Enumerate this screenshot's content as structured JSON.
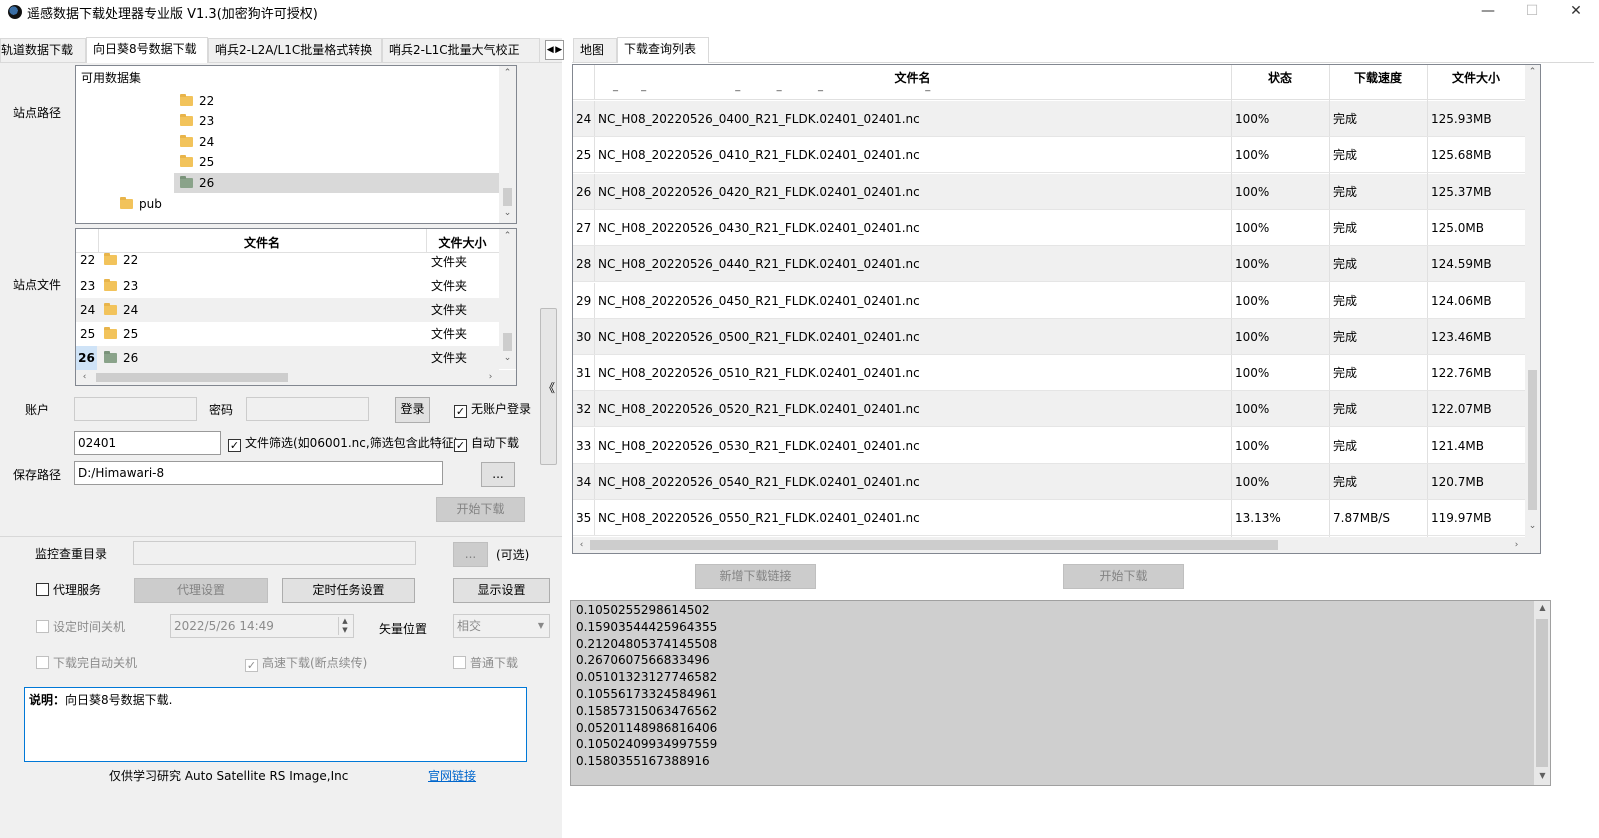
{
  "window": {
    "title": "遥感数据下载处理器专业版 V1.3(加密狗许可授权)",
    "minimize": "—",
    "maximize": "☐",
    "close": "✕"
  },
  "left_tabs": [
    "轨道数据下载",
    "向日葵8号数据下载",
    "哨兵2-L2A/L1C批量格式转换",
    "哨兵2-L1C批量大气校正"
  ],
  "tab_scroll": {
    "left": "◀",
    "right": "▶"
  },
  "station_path": {
    "label": "站点路径",
    "root": "可用数据集",
    "items": [
      "22",
      "23",
      "24",
      "25",
      "26"
    ],
    "selected": "26",
    "pub": "pub"
  },
  "station_files": {
    "label": "站点文件",
    "col_name": "文件名",
    "col_size": "文件大小",
    "rows": [
      {
        "idx": "22",
        "name": "22",
        "size": "文件夹"
      },
      {
        "idx": "23",
        "name": "23",
        "size": "文件夹"
      },
      {
        "idx": "24",
        "name": "24",
        "size": "文件夹"
      },
      {
        "idx": "25",
        "name": "25",
        "size": "文件夹"
      },
      {
        "idx": "26",
        "name": "26",
        "size": "文件夹"
      }
    ]
  },
  "collapse_glyph": "《",
  "account": {
    "label": "账户",
    "password_label": "密码",
    "login_button": "登录",
    "no_account_login": "无账户登录"
  },
  "filter": {
    "value": "02401",
    "label": "文件筛选(如06001.nc,筛选包含此特征)",
    "auto_download": "自动下载"
  },
  "save": {
    "label": "保存路径",
    "value": "D:/Himawari-8",
    "browse": "...",
    "start": "开始下载"
  },
  "monitor": {
    "label": "监控查重目录",
    "browse": "...",
    "optional": "(可选)"
  },
  "proxy": {
    "label": "代理服务",
    "settings": "代理设置",
    "timer": "定时任务设置",
    "display": "显示设置"
  },
  "shutdown": {
    "label": "设定时间关机",
    "datetime": "2022/5/26 14:49",
    "vector_label": "矢量位置",
    "vector_value": "相交"
  },
  "after_download": {
    "auto_shutdown": "下载完自动关机",
    "high_speed": "高速下载(断点续传)",
    "normal": "普通下载"
  },
  "note": {
    "bold": "说明：",
    "text": "向日葵8号数据下载."
  },
  "footer": {
    "text": "仅供学习研究   Auto Satellite RS Image,Inc",
    "link": "官网链接"
  },
  "right_tabs": [
    "地图",
    "下载查询列表"
  ],
  "grid": {
    "col_name": "文件名",
    "col_status": "状态",
    "col_speed": "下载速度",
    "col_size": "文件大小",
    "rows": [
      {
        "idx": "24",
        "name": "NC_H08_20220526_0400_R21_FLDK.02401_02401.nc",
        "status": "100%",
        "speed": "完成",
        "size": "125.93MB"
      },
      {
        "idx": "25",
        "name": "NC_H08_20220526_0410_R21_FLDK.02401_02401.nc",
        "status": "100%",
        "speed": "完成",
        "size": "125.68MB"
      },
      {
        "idx": "26",
        "name": "NC_H08_20220526_0420_R21_FLDK.02401_02401.nc",
        "status": "100%",
        "speed": "完成",
        "size": "125.37MB"
      },
      {
        "idx": "27",
        "name": "NC_H08_20220526_0430_R21_FLDK.02401_02401.nc",
        "status": "100%",
        "speed": "完成",
        "size": "125.0MB"
      },
      {
        "idx": "28",
        "name": "NC_H08_20220526_0440_R21_FLDK.02401_02401.nc",
        "status": "100%",
        "speed": "完成",
        "size": "124.59MB"
      },
      {
        "idx": "29",
        "name": "NC_H08_20220526_0450_R21_FLDK.02401_02401.nc",
        "status": "100%",
        "speed": "完成",
        "size": "124.06MB"
      },
      {
        "idx": "30",
        "name": "NC_H08_20220526_0500_R21_FLDK.02401_02401.nc",
        "status": "100%",
        "speed": "完成",
        "size": "123.46MB"
      },
      {
        "idx": "31",
        "name": "NC_H08_20220526_0510_R21_FLDK.02401_02401.nc",
        "status": "100%",
        "speed": "完成",
        "size": "122.76MB"
      },
      {
        "idx": "32",
        "name": "NC_H08_20220526_0520_R21_FLDK.02401_02401.nc",
        "status": "100%",
        "speed": "完成",
        "size": "122.07MB"
      },
      {
        "idx": "33",
        "name": "NC_H08_20220526_0530_R21_FLDK.02401_02401.nc",
        "status": "100%",
        "speed": "完成",
        "size": "121.4MB"
      },
      {
        "idx": "34",
        "name": "NC_H08_20220526_0540_R21_FLDK.02401_02401.nc",
        "status": "100%",
        "speed": "完成",
        "size": "120.7MB"
      },
      {
        "idx": "35",
        "name": "NC_H08_20220526_0550_R21_FLDK.02401_02401.nc",
        "status": "13.13%",
        "speed": "7.87MB/S",
        "size": "119.97MB"
      }
    ]
  },
  "right_buttons": {
    "add_link": "新增下载链接",
    "start": "开始下载"
  },
  "log_lines": [
    "0.1050255298614502",
    "0.15903544425964355",
    "0.21204805374145508",
    "0.2670607566833496",
    "0.05101323127746582",
    "0.10556173324584961",
    "0.15857315063476562",
    "0.05201148986816406",
    "0.10502409934997559",
    "0.1580355167388916"
  ]
}
